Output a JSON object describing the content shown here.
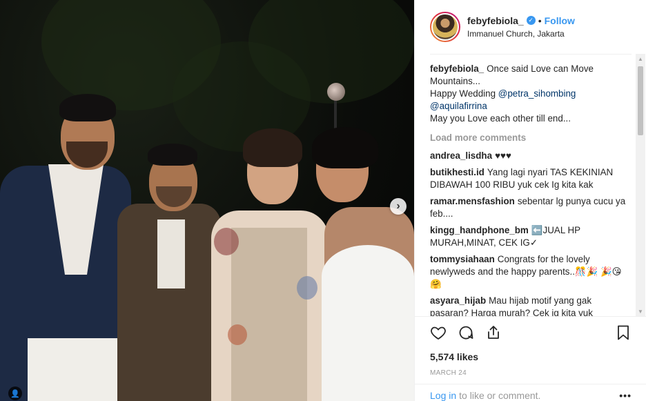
{
  "header": {
    "username": "febyfebiola_",
    "dot": "•",
    "follow_label": "Follow",
    "location": "Immanuel Church, Jakarta"
  },
  "caption": {
    "username": "febyfebiola_",
    "text_before": "Once said Love can Move Mountains...",
    "line2_prefix": "Happy Wedding ",
    "mention1": "@petra_sihombing",
    "mention2": "@aquilafirrina",
    "line4": "May you Love each other till end..."
  },
  "load_more_label": "Load more comments",
  "comments": [
    {
      "user": "andrea_lisdha",
      "text": "♥♥♥"
    },
    {
      "user": "butikhesti.id",
      "text": "Yang lagi nyari TAS KEKINIAN DIBAWAH 100 RIBU yuk cek Ig kita kak"
    },
    {
      "user": "ramar.mensfashion",
      "text": "sebentar lg punya cucu ya feb...."
    },
    {
      "user": "kingg_handphone_bm",
      "text": "⬅️JUAL HP MURAH,MINAT, CEK IG✓"
    },
    {
      "user": "tommysiahaan",
      "text": "Congrats for the lovely newlyweds and the happy parents..🎊🎉 🎉😘🤗"
    },
    {
      "user": "asyara_hijab",
      "text": "Mau hijab motif yang gak pasaran? Harga murah? Cek ig kita yuk"
    }
  ],
  "likes": "5,574 likes",
  "date": "MARCH 24",
  "login": {
    "link": "Log in",
    "rest": "to like or comment.",
    "more": "•••"
  },
  "photo": {
    "nav_arrow": "›",
    "tag_icon": "person-icon"
  }
}
